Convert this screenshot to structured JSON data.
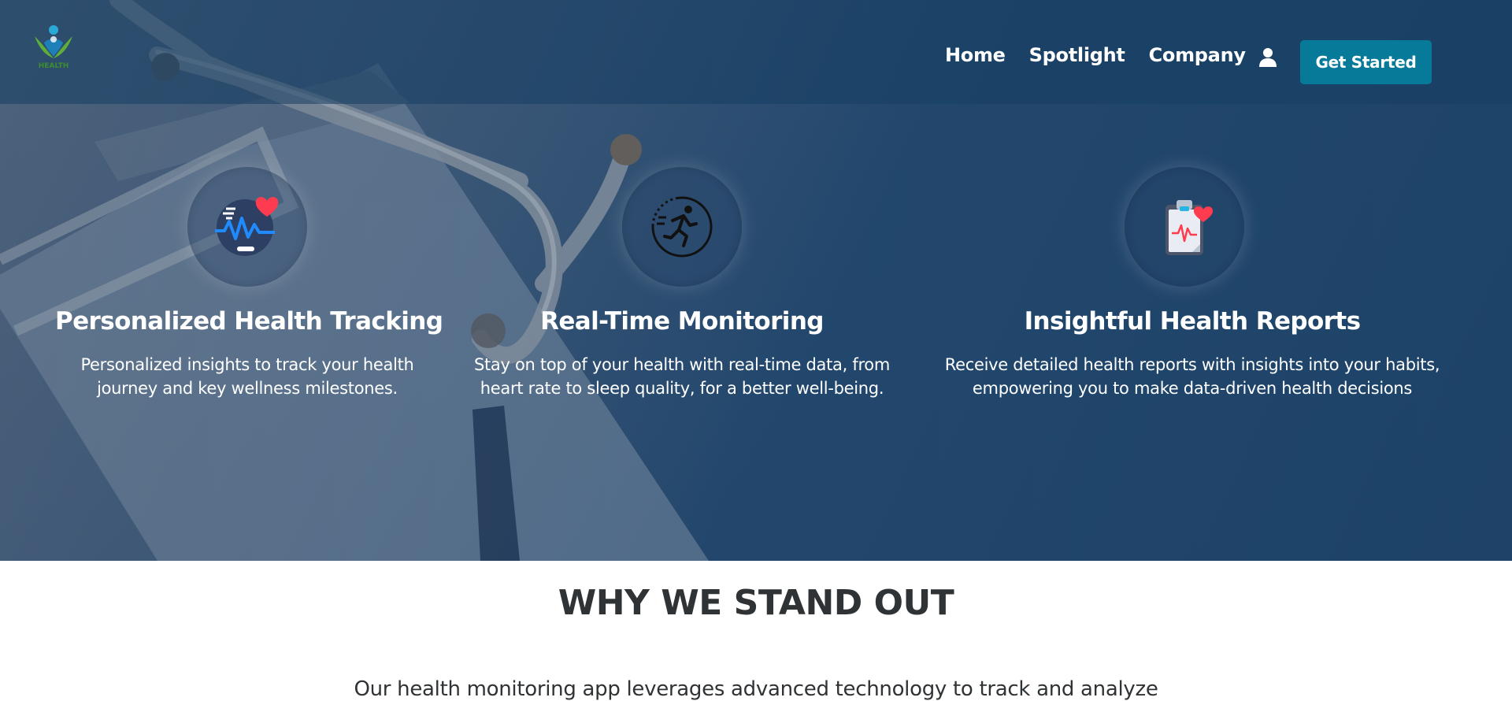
{
  "brand": {
    "logo_text": "HEALTH"
  },
  "nav": {
    "links": [
      "Home",
      "Spotlight",
      "Company"
    ],
    "cta_label": "Get Started",
    "account_icon": "user-icon"
  },
  "features": [
    {
      "icon": "heart-rate-icon",
      "title": "Personalized Health Tracking",
      "description_line1": "Personalized insights to track your health",
      "description_line2": "journey and key wellness milestones."
    },
    {
      "icon": "runner-icon",
      "title": "Real-Time Monitoring",
      "description_line1": "Stay on top of your health with real-time data, from",
      "description_line2": "heart rate to sleep quality, for a better well-being."
    },
    {
      "icon": "clipboard-report-icon",
      "title": "Insightful Health Reports",
      "description_line1": "Receive detailed health reports with insights into your habits,",
      "description_line2": "empowering you to make data-driven health decisions"
    }
  ],
  "section": {
    "title": "WHY WE STAND OUT",
    "intro": "Our health monitoring app leverages advanced technology to track and analyze"
  },
  "colors": {
    "nav_bg": "#163e62",
    "cta_bg": "#087a99",
    "heart": "#ff3b4f",
    "heading_dark": "#2f3335"
  }
}
